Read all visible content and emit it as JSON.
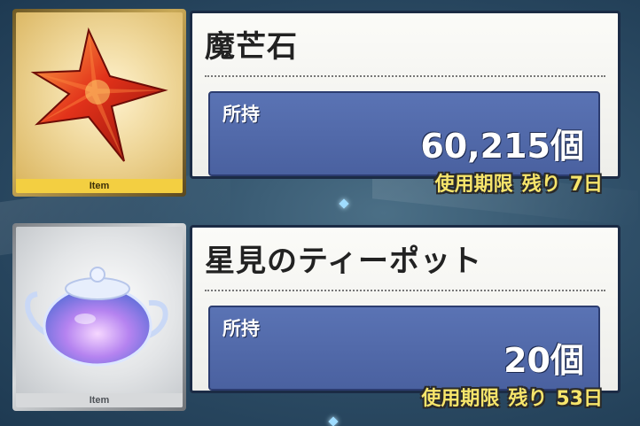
{
  "items": [
    {
      "name": "魔芒石",
      "icon": "red-crystal-star-icon",
      "rarity_color": "#f3cf41",
      "type_label": "Item",
      "owned_label": "所持",
      "owned_value": "60,215個",
      "expiry_label": "使用期限",
      "expiry_remaining": "残り",
      "expiry_days": "7日"
    },
    {
      "name": "星見のティーポット",
      "icon": "glass-teapot-icon",
      "rarity_color": "#d7d9db",
      "type_label": "Item",
      "owned_label": "所持",
      "owned_value": "20個",
      "expiry_label": "使用期限",
      "expiry_remaining": "残り",
      "expiry_days": "53日"
    }
  ]
}
